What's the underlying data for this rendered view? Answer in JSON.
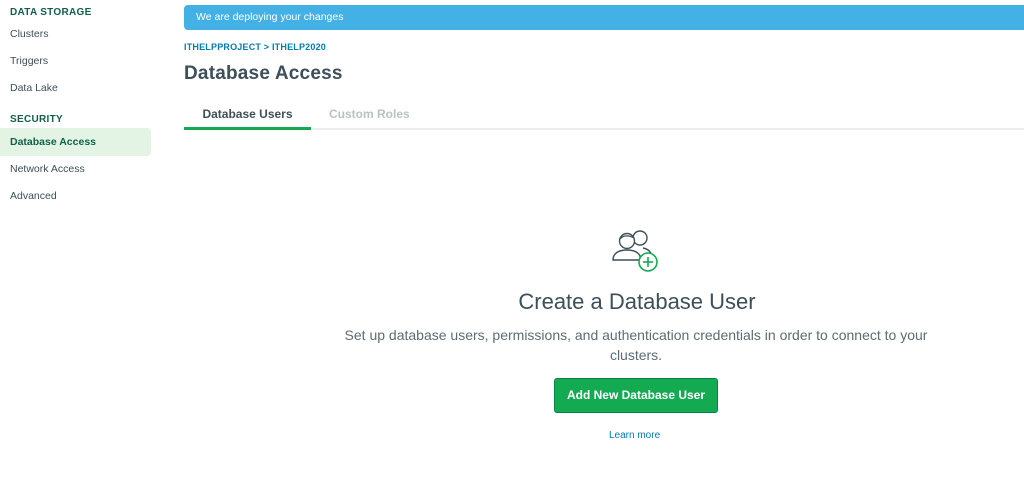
{
  "sidebar": {
    "data_storage_heading": "DATA STORAGE",
    "data_storage_items": [
      {
        "label": "Clusters"
      },
      {
        "label": "Triggers"
      },
      {
        "label": "Data Lake"
      }
    ],
    "security_heading": "SECURITY",
    "security_items": [
      {
        "label": "Database Access",
        "active": true
      },
      {
        "label": "Network Access"
      },
      {
        "label": "Advanced"
      }
    ]
  },
  "banner": {
    "text": "We are deploying your changes"
  },
  "breadcrumb": "ITHELPPROJECT > ITHELP2020",
  "page_title": "Database Access",
  "tabs": [
    {
      "label": "Database Users",
      "active": true
    },
    {
      "label": "Custom Roles",
      "active": false
    }
  ],
  "empty_state": {
    "icon": "users-add-icon",
    "title": "Create a Database User",
    "description": "Set up database users, permissions, and authentication credentials in order to connect to your clusters.",
    "button_label": "Add New Database User",
    "link_label": "Learn more"
  },
  "colors": {
    "accent_green": "#13aa52",
    "dark_green": "#116149",
    "banner_blue": "#43b1e5",
    "link_blue": "#007cad",
    "active_nav_bg": "#e4f4e4"
  }
}
